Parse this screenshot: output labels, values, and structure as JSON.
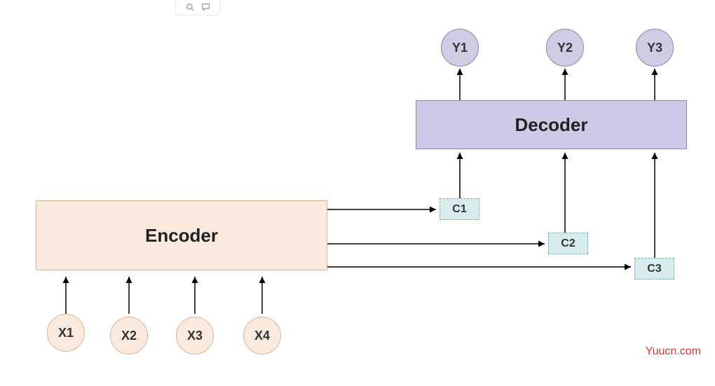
{
  "toolbar": {
    "search_icon": "search-icon",
    "comment_icon": "comment-icon"
  },
  "encoder": {
    "label": "Encoder"
  },
  "decoder": {
    "label": "Decoder"
  },
  "inputs": [
    "X1",
    "X2",
    "X3",
    "X4"
  ],
  "outputs": [
    "Y1",
    "Y2",
    "Y3"
  ],
  "contexts": [
    "C1",
    "C2",
    "C3"
  ],
  "watermark": "Yuucn.com",
  "colors": {
    "encoder_fill": "#faeadd",
    "encoder_border": "#d9b69a",
    "decoder_fill": "#cfc8e6",
    "decoder_border": "#8d84b0",
    "context_fill": "#d8ecee",
    "context_border": "#7bb0b8"
  }
}
